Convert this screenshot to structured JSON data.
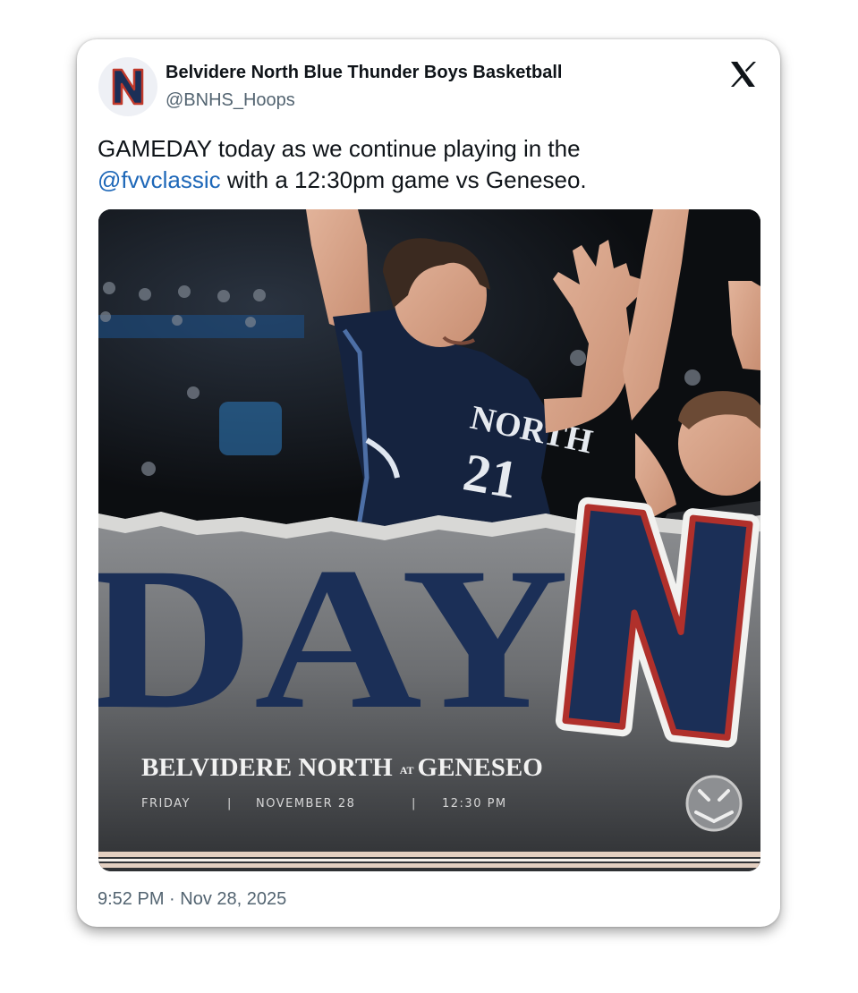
{
  "account": {
    "display_name": "Belvidere North Blue Thunder Boys Basketball",
    "handle": "@BNHS_Hoops",
    "avatar_letter": "N"
  },
  "platform_icon": "x-logo-icon",
  "tweet": {
    "line1": "GAMEDAY today as we continue playing in the",
    "mention": "@fvvclassic",
    "line2_rest": " with a 12:30pm game vs Geneseo."
  },
  "graphic": {
    "headline": "DAY",
    "logo_letter": "N",
    "jersey_text": "NORTH",
    "jersey_number": "21",
    "matchup_home": "BELVIDERE NORTH",
    "matchup_at": "AT",
    "matchup_away": "GENESEO",
    "day": "FRIDAY",
    "date": "NOVEMBER 28",
    "time": "12:30 PM",
    "badge_icon": "tournament-badge-icon"
  },
  "timestamp": "9:52 PM · Nov 28, 2025",
  "colors": {
    "mention": "#1d67b8",
    "navy": "#1b2f57",
    "red_outline": "#b0302b"
  }
}
